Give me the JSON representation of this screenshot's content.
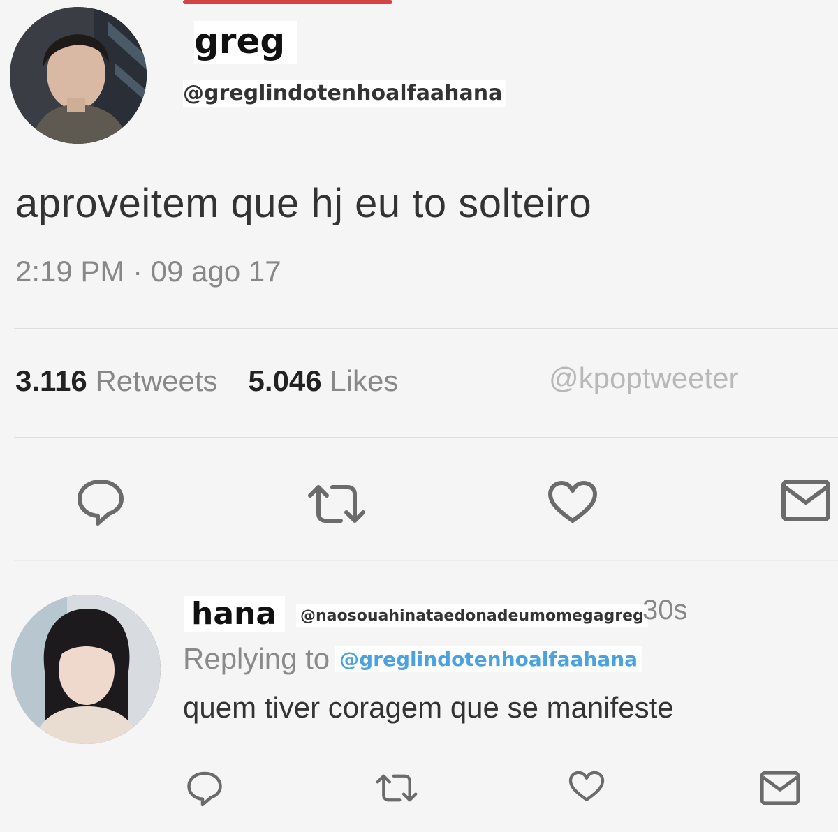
{
  "tweet": {
    "display_name": "greg",
    "handle": "@greglindotenhoalfaahana",
    "text": "aproveitem que hj eu to solteiro",
    "timestamp": "2:19 PM · 09 ago 17",
    "retweets_count": "3.116",
    "retweets_label": "Retweets",
    "likes_count": "5.046",
    "likes_label": "Likes",
    "watermark": "@kpoptweeter",
    "actions": [
      "reply-icon",
      "retweet-icon",
      "like-icon",
      "message-icon"
    ]
  },
  "reply": {
    "display_name": "hana",
    "handle": "@naosouahinataedonadeumomegagreg",
    "time": "30s",
    "replying_label": "Replying to",
    "replying_to": "@greglindotenhoalfaahana",
    "text": "quem tiver coragem que se manifeste",
    "actions": [
      "reply-icon",
      "retweet-icon",
      "like-icon",
      "message-icon"
    ]
  },
  "colors": {
    "background": "#f5f5f5",
    "mention_blue": "#4aa3e0",
    "muted_gray": "#888888",
    "icon_gray": "#6b6b6b",
    "divider": "#dedede"
  }
}
